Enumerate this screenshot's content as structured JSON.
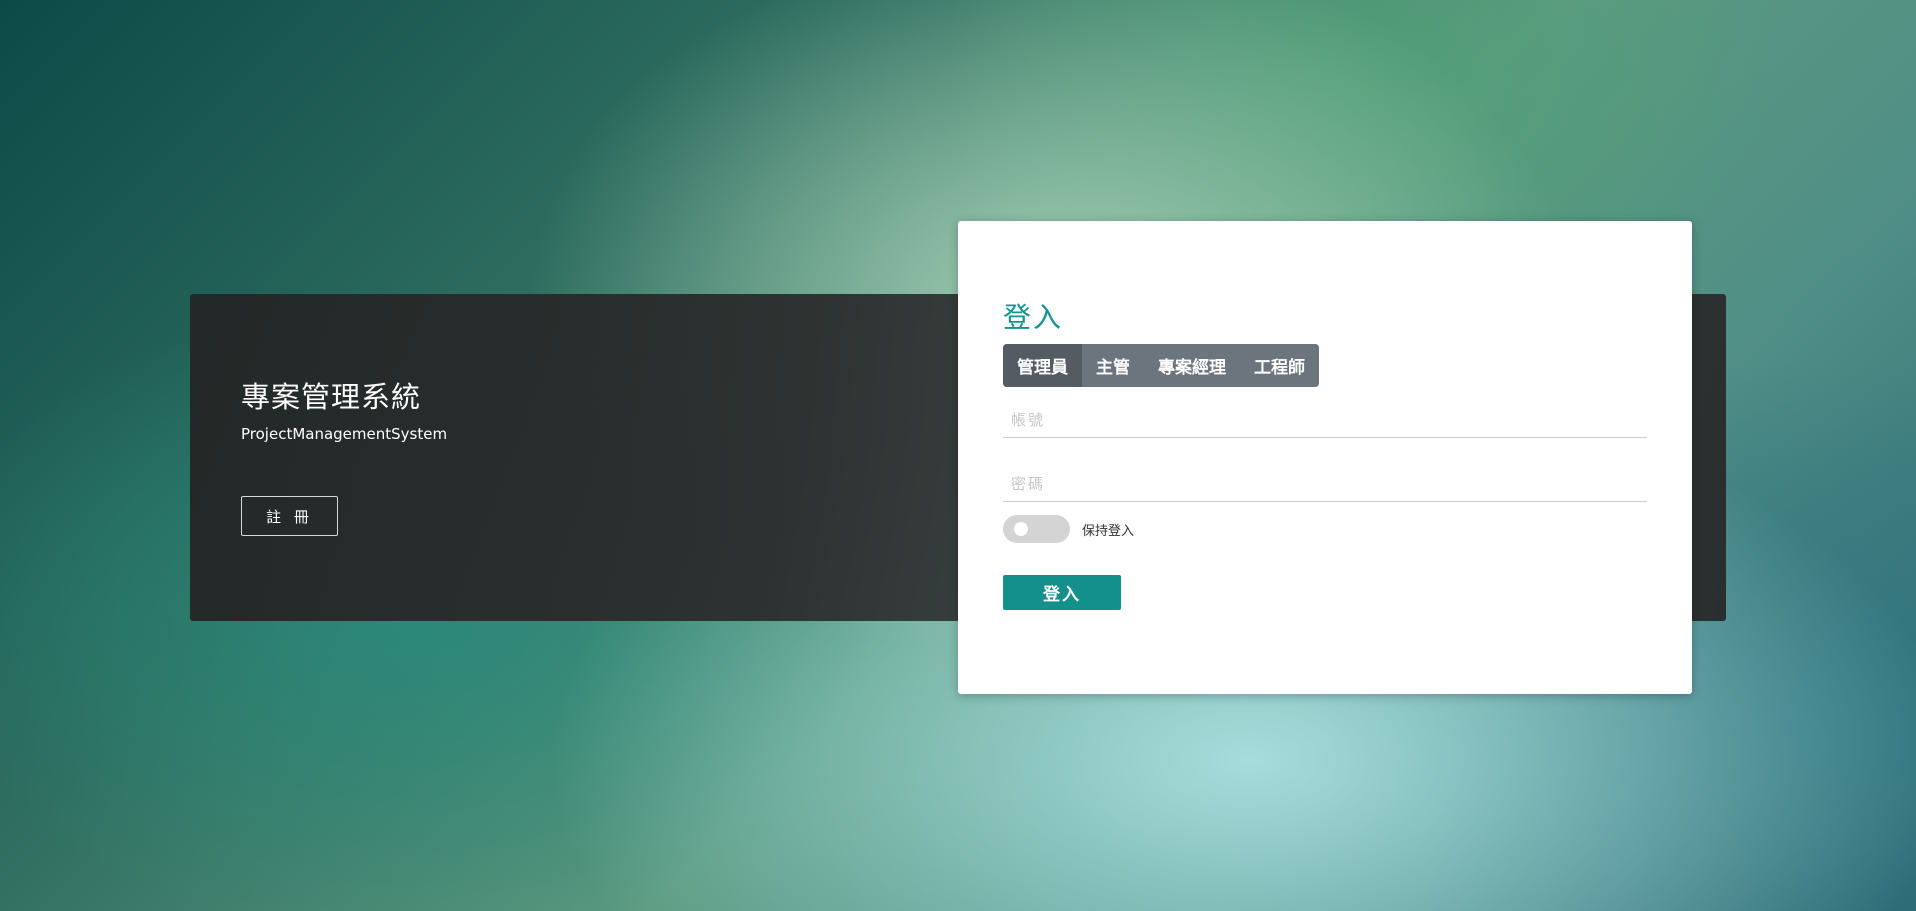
{
  "brand": {
    "title": "專案管理系統",
    "subtitle": "ProjectManagementSystem",
    "register_label": "註 冊"
  },
  "login": {
    "heading": "登入",
    "roles": [
      {
        "label": "管理員",
        "active": true
      },
      {
        "label": "主管",
        "active": false
      },
      {
        "label": "專案經理",
        "active": false
      },
      {
        "label": "工程師",
        "active": false
      }
    ],
    "account": {
      "placeholder": "帳號",
      "value": ""
    },
    "password": {
      "placeholder": "密碼",
      "value": ""
    },
    "remember": {
      "label": "保持登入",
      "checked": false
    },
    "submit_label": "登入"
  },
  "colors": {
    "accent": "#14908c",
    "tab_bg": "#6c757d",
    "tab_active_bg": "#545b62",
    "panel_bg": "#2a2d2d"
  }
}
